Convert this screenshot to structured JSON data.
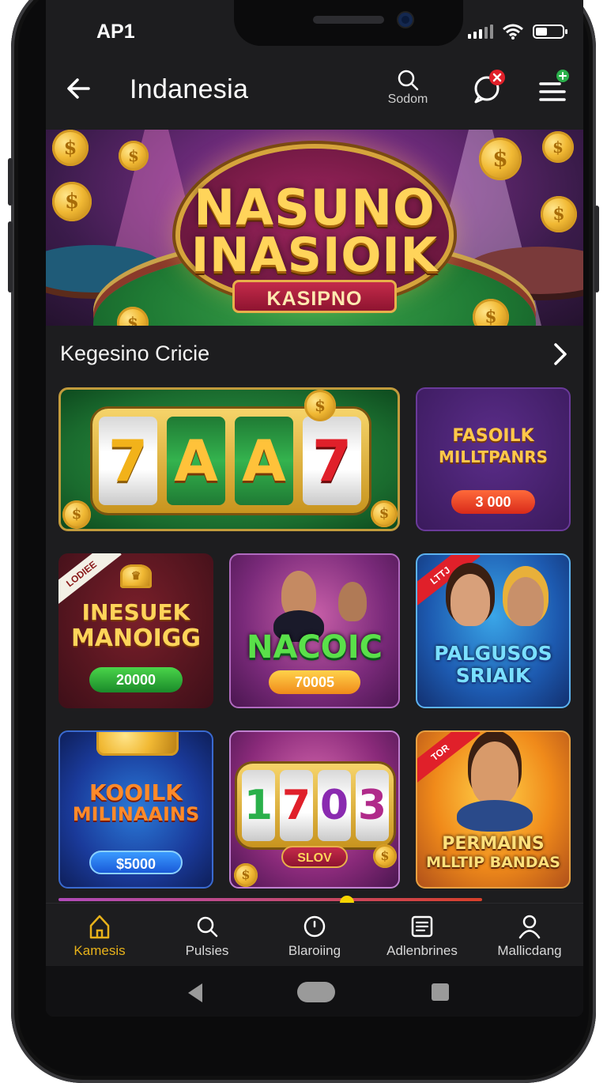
{
  "status_bar": {
    "carrier": "AP1"
  },
  "header": {
    "title": "Indanesia",
    "search_label": "Sodom"
  },
  "banner": {
    "line1": "NASUNO",
    "line2": "INASIOIK",
    "ribbon": "KASIPNO"
  },
  "section": {
    "title": "Kegesino Cricie"
  },
  "games": {
    "slot_reels": [
      "7",
      "A",
      "A",
      "7"
    ],
    "tile_b": {
      "title_line1": "FASOILK",
      "title_line2": "MILLTPANRS",
      "amount": "3 000"
    },
    "tile_c": {
      "tag": "LODIEE",
      "title_line1": "INESUEK",
      "title_line2": "MANOIGG",
      "amount": "20000"
    },
    "tile_d": {
      "title": "NACOIC",
      "amount": "70005"
    },
    "tile_e": {
      "tag": "LTTJ",
      "title_line1": "PALGUSOS",
      "title_line2": "SRIAIK"
    },
    "tile_f": {
      "title_line1": "KOOILK",
      "title_line2": "MILINAAINS",
      "amount": "$5000"
    },
    "tile_g": {
      "reels": [
        "1",
        "7",
        "0",
        "3"
      ],
      "label": "SLOV"
    },
    "tile_h": {
      "tag": "TOR",
      "title_line1": "PERMAINS",
      "title_line2": "MLLTIP BANDAS"
    }
  },
  "bottom_nav": {
    "items": [
      {
        "label": "Kamesis",
        "icon": "home-icon",
        "active": true
      },
      {
        "label": "Pulsies",
        "icon": "search-icon",
        "active": false
      },
      {
        "label": "Blaroiing",
        "icon": "clock-icon",
        "active": false
      },
      {
        "label": "Adlenbrines",
        "icon": "list-icon",
        "active": false
      },
      {
        "label": "Mallicdang",
        "icon": "user-icon",
        "active": false
      }
    ]
  },
  "colors": {
    "accent": "#e8b21a",
    "background": "#1d1d1f",
    "scroll_indicator": "#f5d400"
  }
}
